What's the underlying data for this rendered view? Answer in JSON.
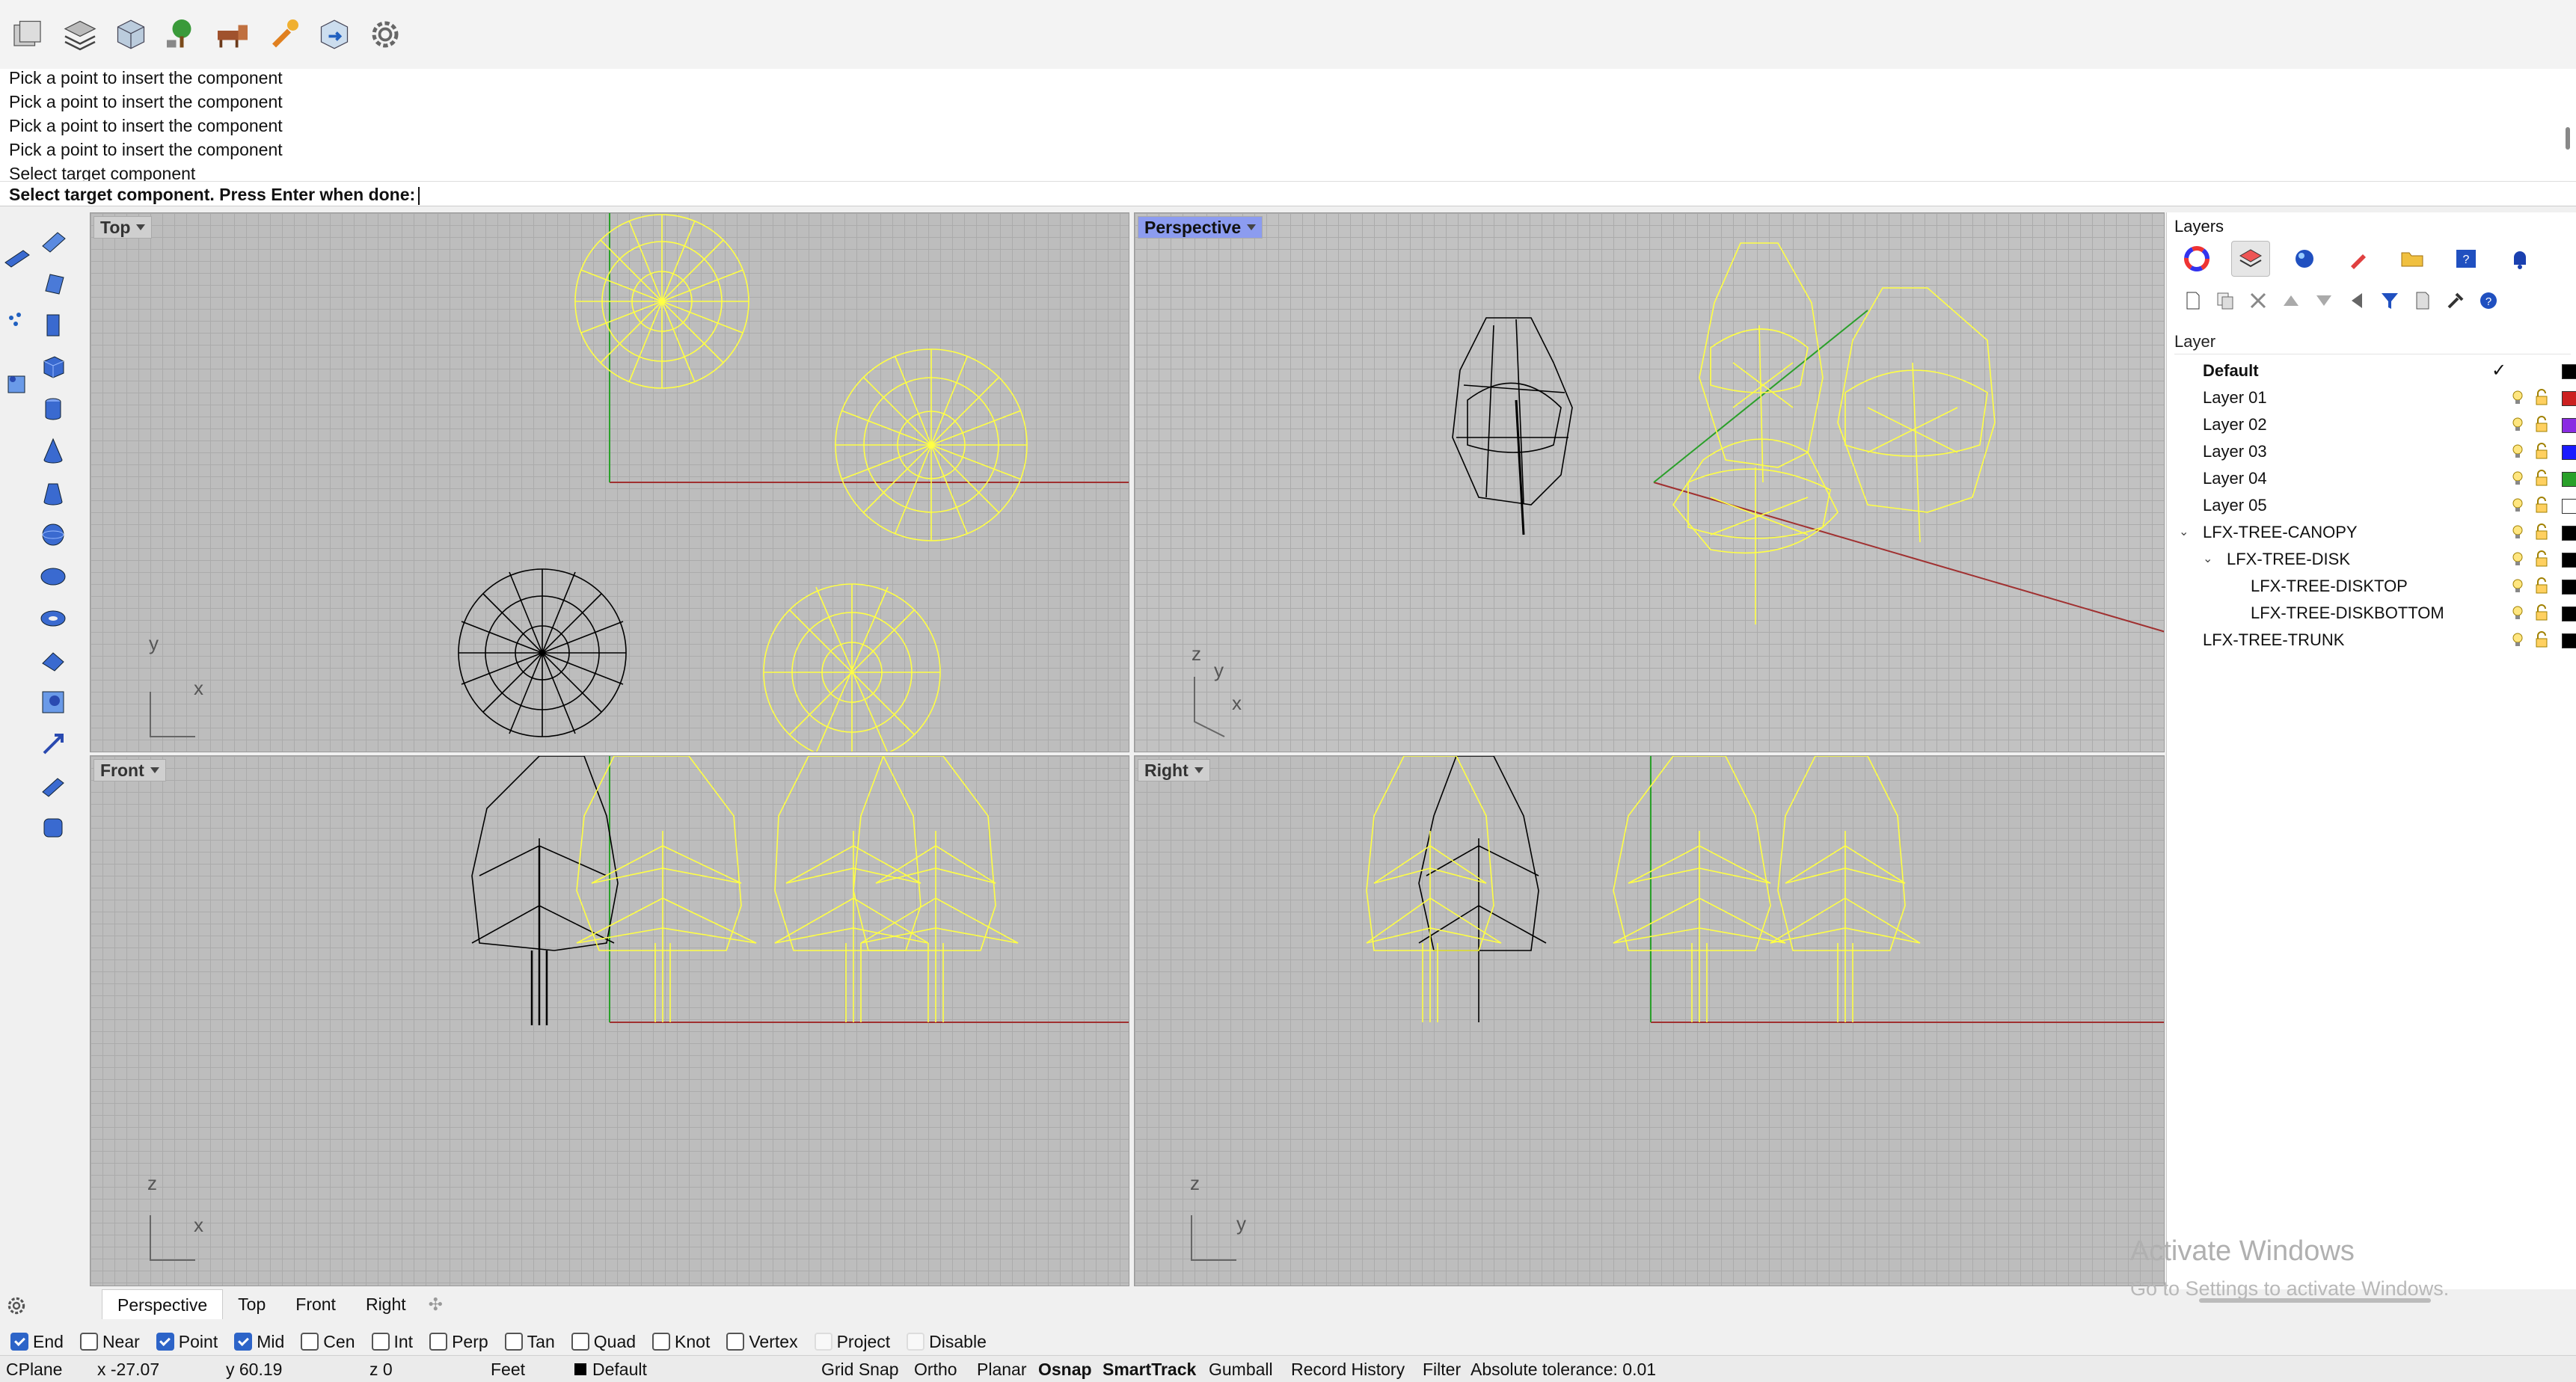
{
  "toolbar": {
    "icons": [
      "layout-icon",
      "layer-state-icon",
      "block-icon",
      "tree-icon",
      "furniture-icon",
      "paint-icon",
      "box-arrow-icon",
      "gear-icon"
    ]
  },
  "command": {
    "history": [
      "Pick a point to insert the component",
      "Pick a point to insert the component",
      "Pick a point to insert the component",
      "Pick a point to insert the component",
      "Select target component"
    ],
    "prompt": "Select target component. Press Enter when done:"
  },
  "viewports": {
    "top": {
      "label": "Top",
      "ax1": "y",
      "ax2": "x"
    },
    "perspective": {
      "label": "Perspective",
      "ax1": "z",
      "ax2": "y",
      "ax3": "x"
    },
    "front": {
      "label": "Front",
      "ax1": "z",
      "ax2": "x"
    },
    "right": {
      "label": "Right",
      "ax1": "z",
      "ax2": "y"
    }
  },
  "viewport_tabs": [
    "Perspective",
    "Top",
    "Front",
    "Right"
  ],
  "layers_panel": {
    "title": "Layers",
    "column_header": "Layer",
    "layers": [
      {
        "name": "Default",
        "current": true,
        "color": "#000000"
      },
      {
        "name": "Layer 01",
        "color": "#cc2020"
      },
      {
        "name": "Layer 02",
        "color": "#8a2be2"
      },
      {
        "name": "Layer 03",
        "color": "#1a1aff"
      },
      {
        "name": "Layer 04",
        "color": "#2aa02a"
      },
      {
        "name": "Layer 05",
        "color": "#ffffff"
      },
      {
        "name": "LFX-TREE-CANOPY",
        "expanded": true,
        "color": "#000000"
      },
      {
        "name": "LFX-TREE-DISK",
        "expanded": true,
        "color": "#000000"
      },
      {
        "name": "LFX-TREE-DISKTOP",
        "color": "#000000"
      },
      {
        "name": "LFX-TREE-DISKBOTTOM",
        "color": "#000000"
      },
      {
        "name": "LFX-TREE-TRUNK",
        "color": "#000000"
      }
    ]
  },
  "watermark": {
    "line1": "Activate Windows",
    "line2": "Go to Settings to activate Windows."
  },
  "osnap": [
    {
      "label": "End",
      "checked": true
    },
    {
      "label": "Near",
      "checked": false
    },
    {
      "label": "Point",
      "checked": true
    },
    {
      "label": "Mid",
      "checked": true
    },
    {
      "label": "Cen",
      "checked": false
    },
    {
      "label": "Int",
      "checked": false
    },
    {
      "label": "Perp",
      "checked": false
    },
    {
      "label": "Tan",
      "checked": false
    },
    {
      "label": "Quad",
      "checked": false
    },
    {
      "label": "Knot",
      "checked": false
    },
    {
      "label": "Vertex",
      "checked": false
    },
    {
      "label": "Project",
      "checked": false,
      "disabled": true
    },
    {
      "label": "Disable",
      "checked": false,
      "disabled": true
    }
  ],
  "status": {
    "cplane": "CPlane",
    "x": "x -27.07",
    "y": "y 60.19",
    "z": "z 0",
    "units": "Feet",
    "layer": "Default",
    "grid_snap": "Grid Snap",
    "ortho": "Ortho",
    "planar": "Planar",
    "osnap": "Osnap",
    "smarttrack": "SmartTrack",
    "gumball": "Gumball",
    "record_history": "Record History",
    "filter": "Filter",
    "tolerance": "Absolute tolerance: 0.01"
  },
  "colors": {
    "accent": "#8c9cf0",
    "highlight": "#ffff44",
    "object": "#000000",
    "x_axis": "#b03030",
    "y_axis": "#2aa02a"
  }
}
